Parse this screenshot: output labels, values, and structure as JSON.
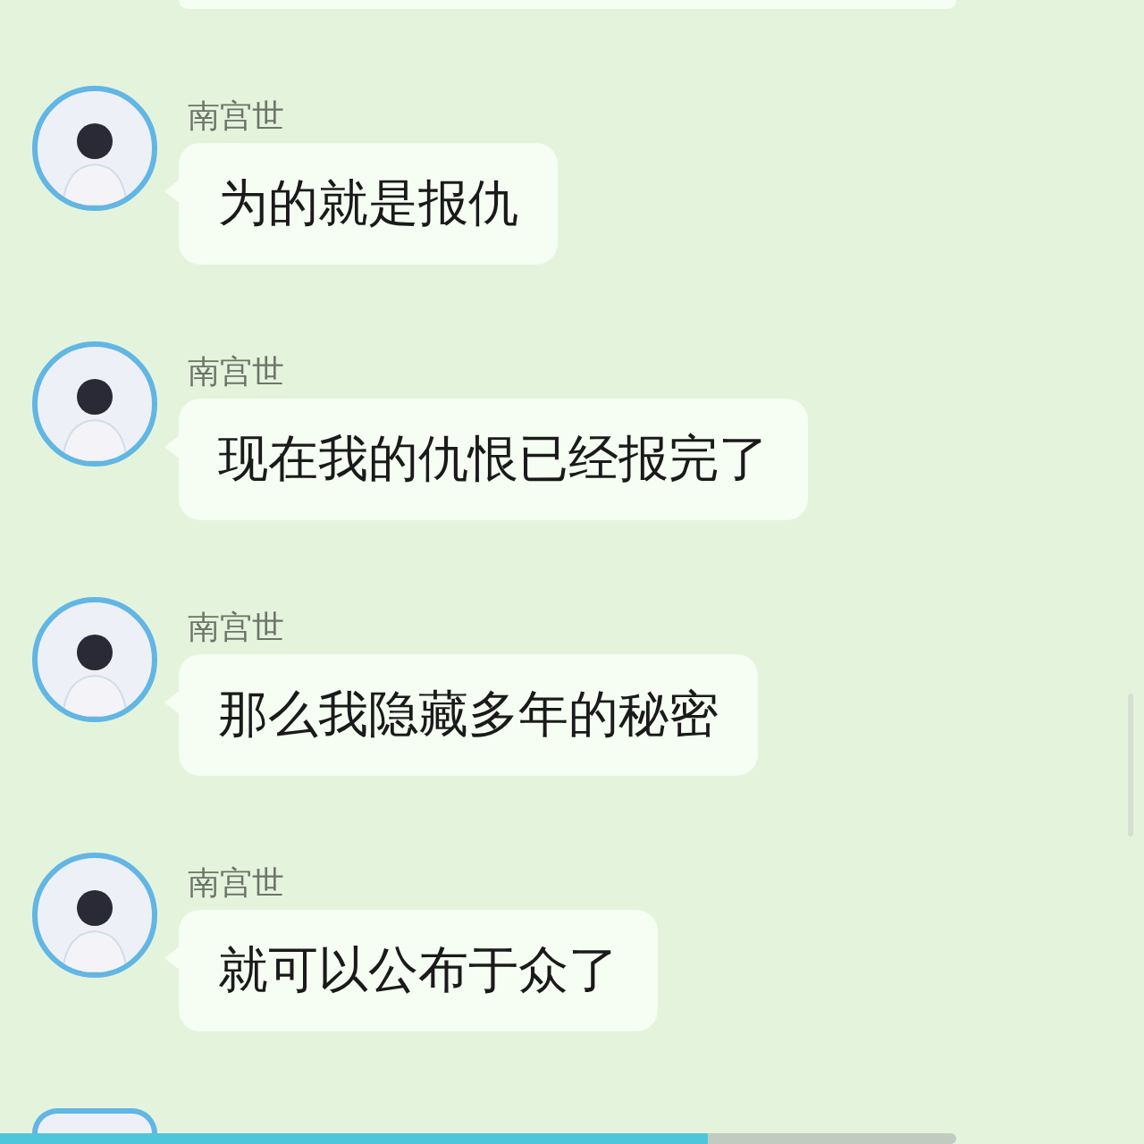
{
  "messages": [
    {
      "sender": "南宫世",
      "text": "为的就是报仇"
    },
    {
      "sender": "南宫世",
      "text": "现在我的仇恨已经报完了"
    },
    {
      "sender": "南宫世",
      "text": "那么我隐藏多年的秘密"
    },
    {
      "sender": "南宫世",
      "text": "就可以公布于众了"
    }
  ],
  "progress": {
    "level": 0.74
  }
}
